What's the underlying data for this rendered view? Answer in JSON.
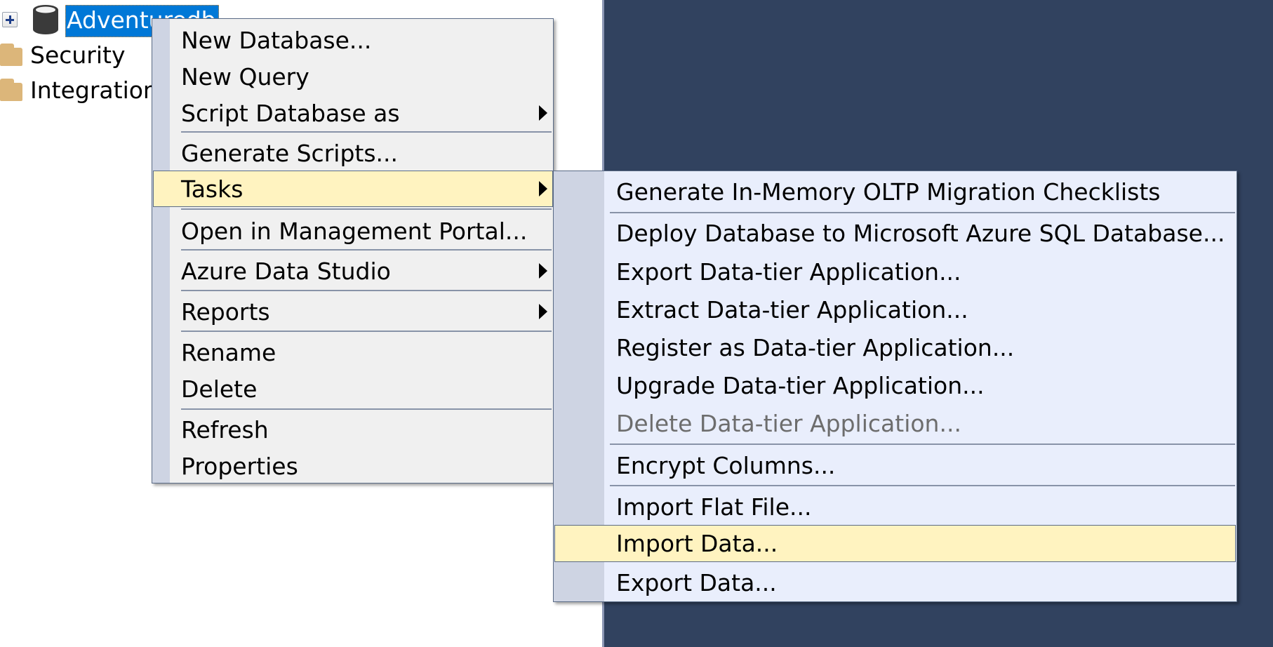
{
  "tree": {
    "nodes": [
      {
        "label": "Adventuredb",
        "icon": "database-icon",
        "expander": "plus-icon",
        "selected": true
      },
      {
        "label": "Security",
        "icon": "folder-icon"
      },
      {
        "label": "Integration",
        "icon": "folder-icon"
      }
    ]
  },
  "context_menu": {
    "items": [
      {
        "label": "New Database..."
      },
      {
        "label": "New Query"
      },
      {
        "label": "Script Database as",
        "submenu": true
      },
      {
        "label": "Generate Scripts..."
      },
      {
        "label": "Tasks",
        "submenu": true,
        "highlighted": true
      },
      {
        "label": "Open in Management Portal..."
      },
      {
        "label": "Azure Data Studio",
        "submenu": true
      },
      {
        "label": "Reports",
        "submenu": true
      },
      {
        "label": "Rename"
      },
      {
        "label": "Delete"
      },
      {
        "label": "Refresh"
      },
      {
        "label": "Properties"
      }
    ]
  },
  "tasks_submenu": {
    "items": [
      {
        "label": "Generate In-Memory OLTP Migration Checklists"
      },
      {
        "label": "Deploy Database to Microsoft Azure SQL Database..."
      },
      {
        "label": "Export Data-tier Application..."
      },
      {
        "label": "Extract Data-tier Application..."
      },
      {
        "label": "Register as Data-tier Application..."
      },
      {
        "label": "Upgrade Data-tier Application..."
      },
      {
        "label": "Delete Data-tier Application...",
        "disabled": true
      },
      {
        "label": "Encrypt Columns..."
      },
      {
        "label": "Import Flat File..."
      },
      {
        "label": "Import Data...",
        "highlighted": true
      },
      {
        "label": "Export Data..."
      }
    ]
  },
  "colors": {
    "selection": "#0078d7",
    "menu_highlight": "#fff3c0",
    "dark_panel": "#31425f",
    "folder": "#dcb67a"
  }
}
